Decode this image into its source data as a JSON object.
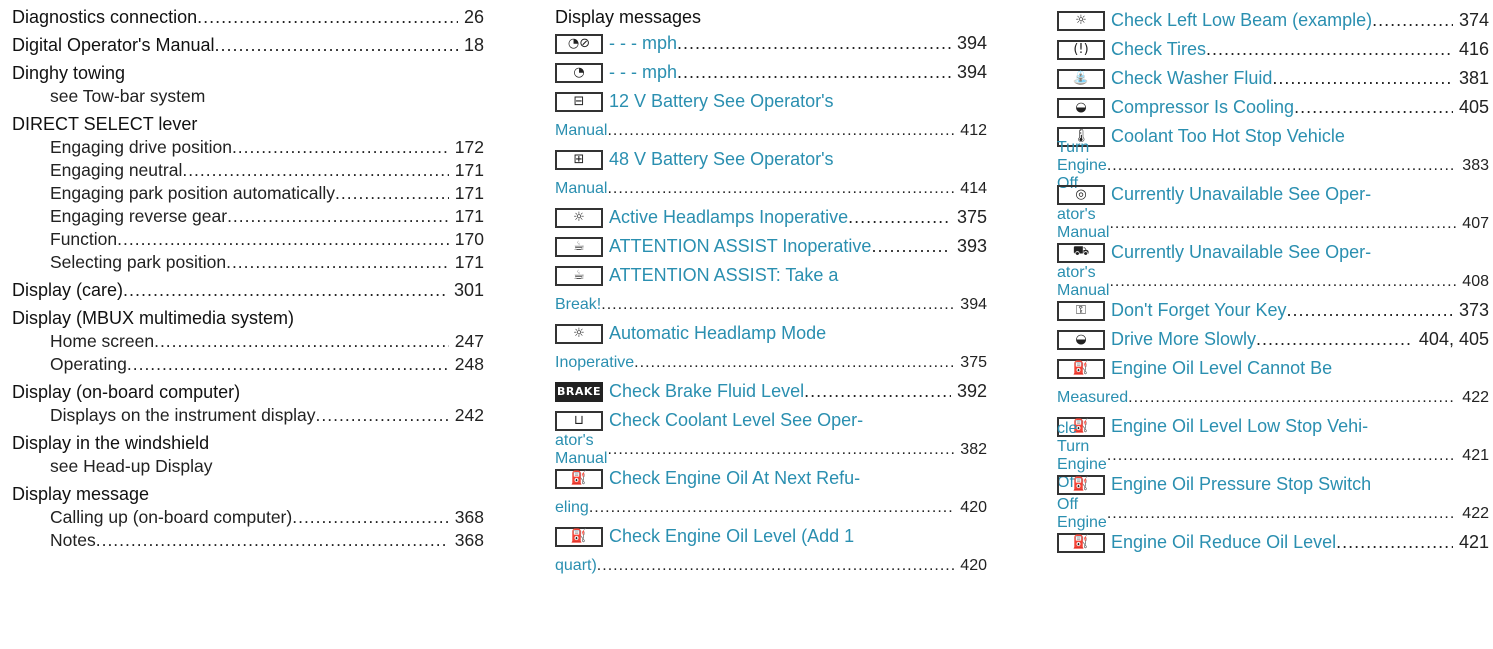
{
  "col1": {
    "diag": {
      "text": "Diagnostics connection",
      "page": "26"
    },
    "dom": {
      "text": "Digital Operator's Manual",
      "page": "18"
    },
    "dinghy": {
      "title": "Dinghy towing",
      "see": "see Tow-bar system"
    },
    "direct": {
      "title": "DIRECT SELECT lever",
      "items": [
        {
          "text": "Engaging drive position",
          "page": "172"
        },
        {
          "text": "Engaging neutral",
          "page": "171"
        },
        {
          "text": "Engaging park position automatically",
          "page": "171"
        },
        {
          "text": "Engaging reverse gear",
          "page": "171"
        },
        {
          "text": "Function",
          "page": "170"
        },
        {
          "text": "Selecting park position",
          "page": "171"
        }
      ]
    },
    "care": {
      "text": "Display (care)",
      "page": "301"
    },
    "mbux": {
      "title": "Display (MBUX multimedia system)",
      "items": [
        {
          "text": "Home screen",
          "page": "247"
        },
        {
          "text": "Operating",
          "page": "248"
        }
      ]
    },
    "obc": {
      "title": "Display (on-board computer)",
      "items": [
        {
          "text": "Displays on the instrument display",
          "page": "242"
        }
      ]
    },
    "wind": {
      "title": "Display in the windshield",
      "see": "see Head-up Display"
    },
    "msg": {
      "title": "Display message",
      "items": [
        {
          "text": "Calling up (on-board computer)",
          "page": "368"
        },
        {
          "text": "Notes",
          "page": "368"
        }
      ]
    }
  },
  "col2": {
    "title": "Display messages",
    "e1": {
      "icon": "speed-camera-icon",
      "glyph": "◔⊘",
      "text": "- - - mph",
      "page": "394"
    },
    "e2": {
      "icon": "speedometer-icon",
      "glyph": "◔",
      "text": "- - - mph",
      "page": "394"
    },
    "e3": {
      "icon": "battery-icon",
      "glyph": "⊟",
      "line1": "12 V Battery See Operator's",
      "line2": "Manual",
      "page": "412"
    },
    "e4": {
      "icon": "battery-48v-icon",
      "glyph": "⊞",
      "line1": "48 V Battery See Operator's",
      "line2": "Manual",
      "page": "414"
    },
    "e5": {
      "icon": "headlamp-icon",
      "glyph": "☼",
      "text": "Active Headlamps Inoperative",
      "page": "375"
    },
    "e6": {
      "icon": "coffee-cup-icon",
      "glyph": "☕",
      "text": "ATTENTION ASSIST Inoperative",
      "page": "393"
    },
    "e7": {
      "icon": "coffee-cup-icon",
      "glyph": "☕",
      "line1": "ATTENTION ASSIST: Take a",
      "line2": "Break!",
      "page": "394"
    },
    "e8": {
      "icon": "headlamp-icon",
      "glyph": "☼",
      "line1": "Automatic Headlamp Mode",
      "line2": "Inoperative",
      "page": "375"
    },
    "e9": {
      "icon": "brake-icon",
      "glyph": "BRAKE",
      "text": "Check Brake Fluid Level",
      "page": "392"
    },
    "e10": {
      "icon": "coolant-level-icon",
      "glyph": "⊔",
      "line1": "Check Coolant Level See Oper-",
      "line2": "ator's Manual",
      "page": "382"
    },
    "e11": {
      "icon": "oil-can-icon",
      "glyph": "⛽",
      "line1": "Check Engine Oil At Next Refu-",
      "line2": "eling",
      "page": "420"
    },
    "e12": {
      "icon": "oil-can-icon",
      "glyph": "⛽",
      "line1": "Check Engine Oil Level (Add 1",
      "line2": "quart)",
      "page": "420"
    }
  },
  "col3": {
    "e1": {
      "icon": "headlamp-icon",
      "glyph": "☼",
      "text": "Check Left Low Beam (example)",
      "page": "374"
    },
    "e2": {
      "icon": "tire-pressure-icon",
      "glyph": "(!)",
      "text": "Check Tires",
      "page": "416"
    },
    "e3": {
      "icon": "washer-fluid-icon",
      "glyph": "⛲",
      "text": "Check Washer Fluid",
      "page": "381"
    },
    "e4": {
      "icon": "car-icon",
      "glyph": "◒",
      "text": "Compressor Is Cooling",
      "page": "405"
    },
    "e5": {
      "icon": "coolant-temp-icon",
      "glyph": "🌡",
      "line1": "Coolant Too Hot Stop Vehicle",
      "line2": "Turn Engine Off",
      "page": "383"
    },
    "e6": {
      "icon": "abs-icon",
      "glyph": "◎",
      "line1": "Currently Unavailable See Oper-",
      "line2": "ator's Manual",
      "page": "407"
    },
    "e7": {
      "icon": "lane-assist-icon",
      "glyph": "⛟",
      "line1": "Currently Unavailable See Oper-",
      "line2": "ator's Manual",
      "page": "408"
    },
    "e8": {
      "icon": "key-icon",
      "glyph": "⚿",
      "text": "Don't Forget Your Key",
      "page": "373"
    },
    "e9": {
      "icon": "car-icon",
      "glyph": "◒",
      "text": "Drive More Slowly",
      "page": "404, 405"
    },
    "e10": {
      "icon": "oil-can-icon",
      "glyph": "⛽",
      "line1": "Engine Oil Level Cannot Be",
      "line2": "Measured",
      "page": "422"
    },
    "e11": {
      "icon": "oil-can-icon",
      "glyph": "⛽",
      "line1": "Engine Oil Level Low Stop Vehi-",
      "line2": "cle Turn Engine Off",
      "page": "421"
    },
    "e12": {
      "icon": "oil-can-icon",
      "glyph": "⛽",
      "line1": "Engine Oil Pressure Stop Switch",
      "line2": "Off Engine",
      "page": "422"
    },
    "e13": {
      "icon": "oil-can-icon",
      "glyph": "⛽",
      "text": "Engine Oil Reduce Oil Level",
      "page": "421"
    }
  }
}
